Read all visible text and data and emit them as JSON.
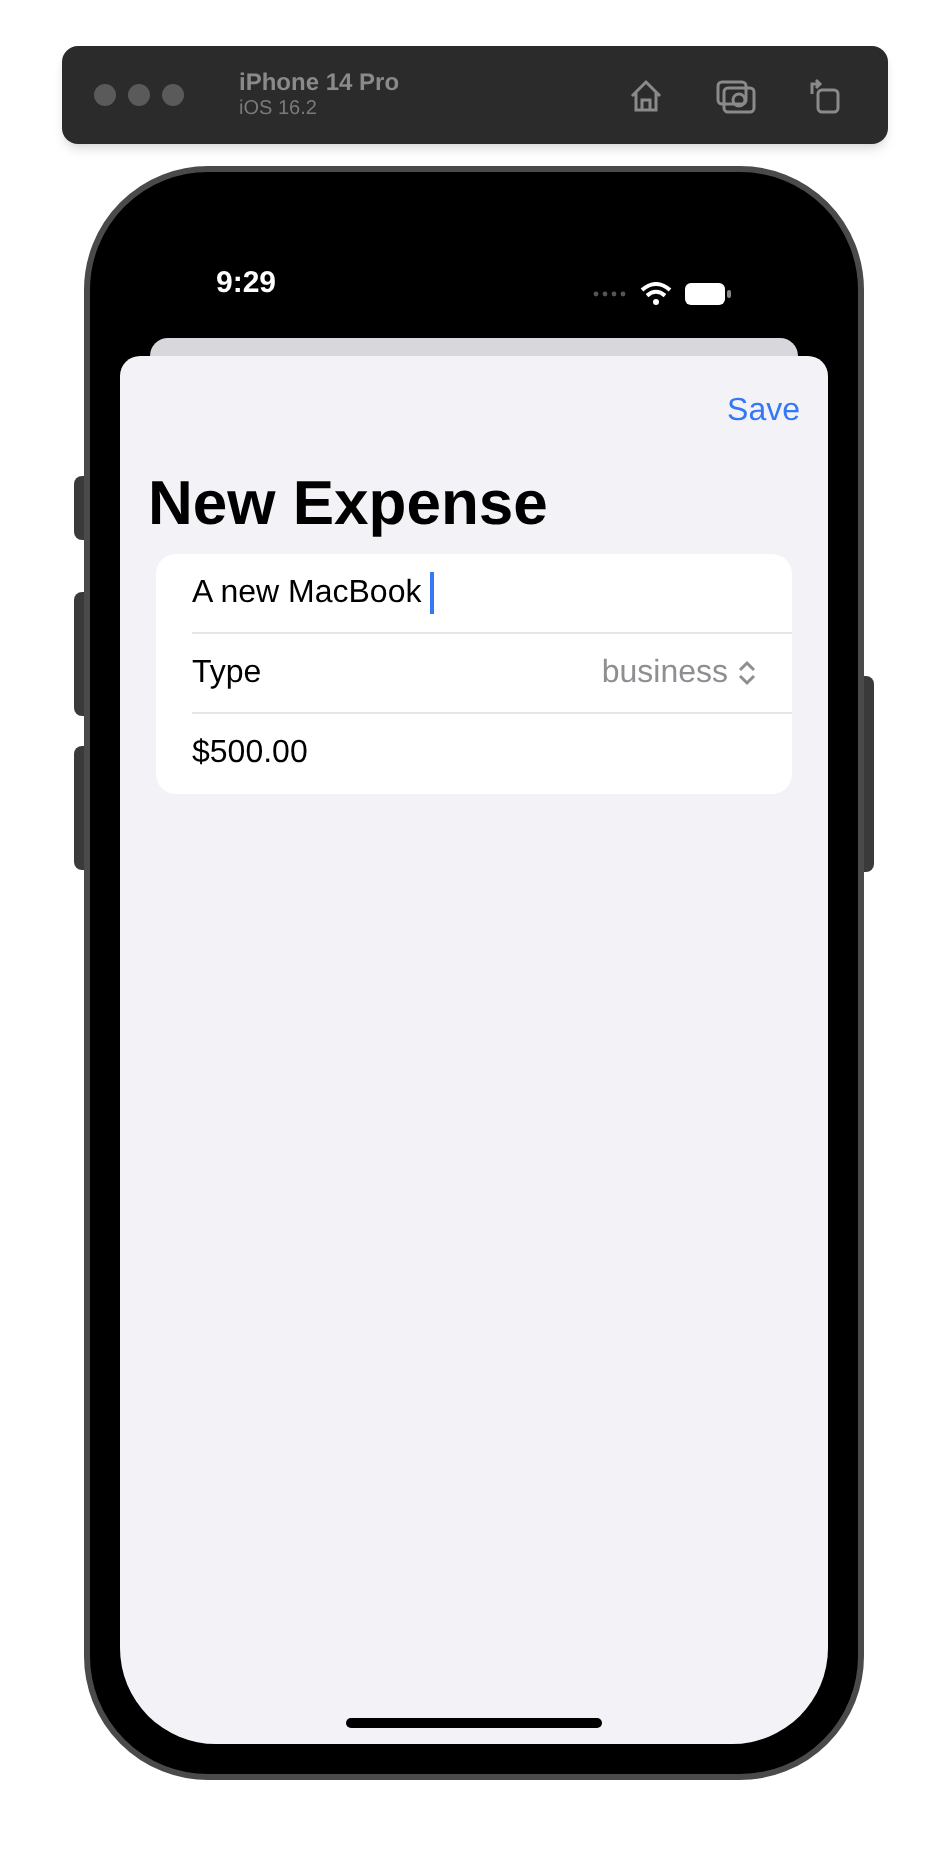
{
  "simulator": {
    "device": "iPhone 14 Pro",
    "os": "iOS 16.2"
  },
  "status_bar": {
    "time": "9:29"
  },
  "nav": {
    "action": "Save"
  },
  "title": "New Expense",
  "form": [
    {
      "kind": "text",
      "value": "A new MacBook",
      "focused": true
    },
    {
      "kind": "picker",
      "label": "Type",
      "value": "business"
    },
    {
      "kind": "text",
      "value": "$500.00",
      "focused": false
    }
  ]
}
